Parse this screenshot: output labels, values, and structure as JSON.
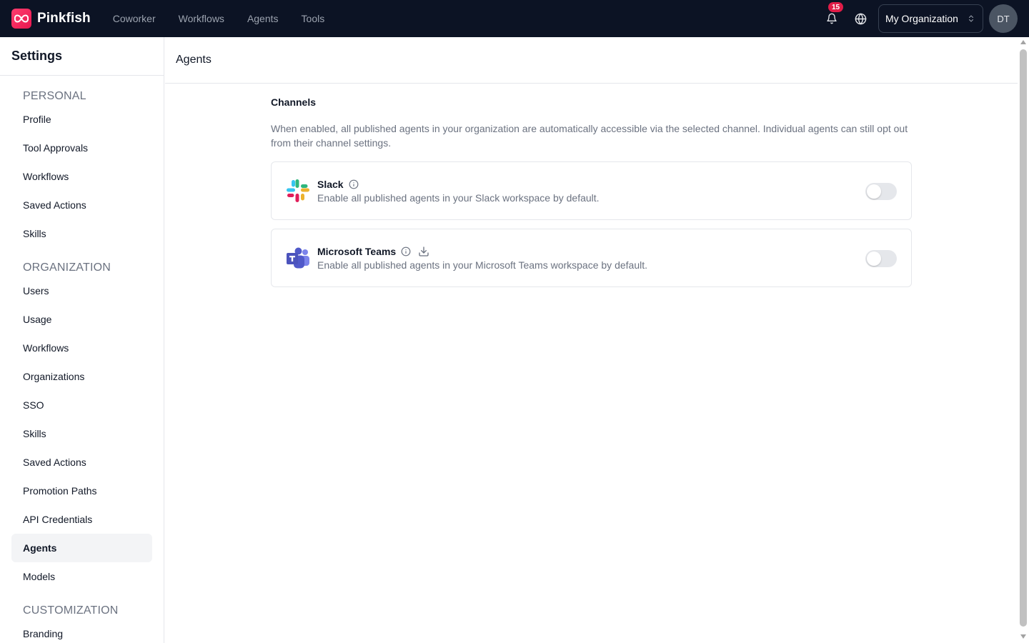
{
  "app": {
    "brand": "Pinkfish",
    "accent_color": "#ff3d6e",
    "nav": [
      {
        "label": "Coworker"
      },
      {
        "label": "Workflows"
      },
      {
        "label": "Agents"
      },
      {
        "label": "Tools"
      }
    ],
    "notifications_count": "15",
    "organization": "My Organization",
    "user_initials": "DT"
  },
  "sidebar": {
    "title": "Settings",
    "groups": [
      {
        "label": "PERSONAL",
        "items": [
          {
            "label": "Profile"
          },
          {
            "label": "Tool Approvals"
          },
          {
            "label": "Workflows"
          },
          {
            "label": "Saved Actions"
          },
          {
            "label": "Skills"
          }
        ]
      },
      {
        "label": "ORGANIZATION",
        "items": [
          {
            "label": "Users"
          },
          {
            "label": "Usage"
          },
          {
            "label": "Workflows"
          },
          {
            "label": "Organizations"
          },
          {
            "label": "SSO"
          },
          {
            "label": "Skills"
          },
          {
            "label": "Saved Actions"
          },
          {
            "label": "Promotion Paths"
          },
          {
            "label": "API Credentials"
          },
          {
            "label": "Agents",
            "active": true
          },
          {
            "label": "Models"
          }
        ]
      },
      {
        "label": "CUSTOMIZATION",
        "items": [
          {
            "label": "Branding"
          }
        ]
      }
    ]
  },
  "main": {
    "header": "Agents",
    "section": {
      "title": "Channels",
      "description": "When enabled, all published agents in your organization are automatically accessible via the selected channel. Individual agents can still opt out from their channel settings."
    },
    "channels": [
      {
        "name": "Slack",
        "icon": "slack-logo",
        "description": "Enable all published agents in your Slack workspace by default.",
        "enabled": false
      },
      {
        "name": "Microsoft Teams",
        "icon": "microsoft-teams-logo",
        "description": "Enable all published agents in your Microsoft Teams workspace by default.",
        "enabled": false
      }
    ]
  }
}
